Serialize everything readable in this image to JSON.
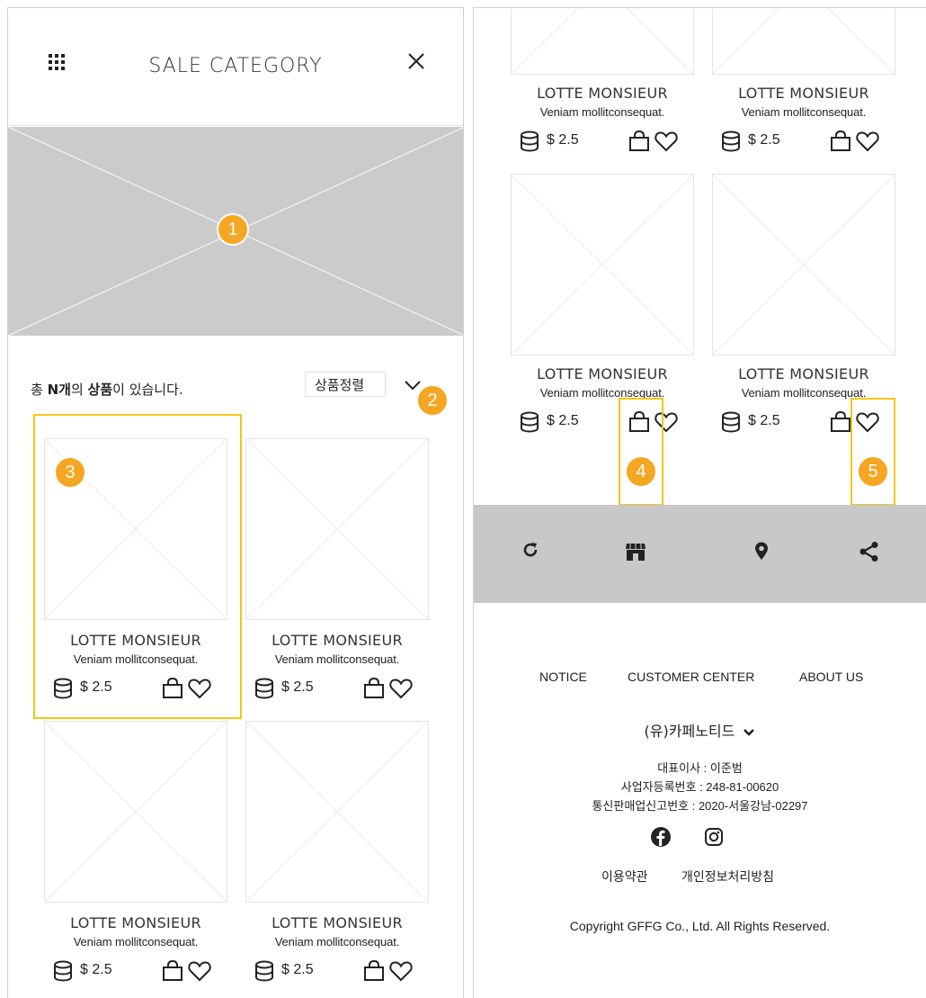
{
  "header": {
    "title": "SALE CATEGORY",
    "menu_icon": "grid-dots-icon",
    "close_icon": "close-icon"
  },
  "list_bar": {
    "count_prefix": "총 ",
    "count_bold_1": "N개",
    "count_mid": "의 ",
    "count_bold_2": "상품",
    "count_suffix": "이 있습니다.",
    "sort_label": "상품정렬"
  },
  "products": [
    {
      "brand": "LOTTE MONSIEUR",
      "name": "Veniam mollitconsequat.",
      "price": "$ 2.5"
    },
    {
      "brand": "LOTTE MONSIEUR",
      "name": "Veniam mollitconsequat.",
      "price": "$ 2.5"
    },
    {
      "brand": "LOTTE MONSIEUR",
      "name": "Veniam mollitconsequat.",
      "price": "$ 2.5"
    },
    {
      "brand": "LOTTE MONSIEUR",
      "name": "Veniam mollitconsequat.",
      "price": "$ 2.5"
    }
  ],
  "right_products": [
    {
      "brand": "LOTTE MONSIEUR",
      "name": "Veniam mollitconsequat.",
      "price": "$ 2.5"
    },
    {
      "brand": "LOTTE MONSIEUR",
      "name": "Veniam mollitconsequat.",
      "price": "$ 2.5"
    },
    {
      "brand": "LOTTE MONSIEUR",
      "name": "Veniam mollitconsequat.",
      "price": "$ 2.5"
    },
    {
      "brand": "LOTTE MONSIEUR",
      "name": "Veniam mollitconsequat.",
      "price": "$ 2.5"
    }
  ],
  "badges": [
    "1",
    "2",
    "3",
    "4",
    "5"
  ],
  "footer_bar": {
    "icons": [
      "refresh-icon",
      "store-icon",
      "location-pin-icon",
      "share-icon"
    ]
  },
  "footer": {
    "links": [
      "NOTICE",
      "CUSTOMER CENTER",
      "ABOUT US"
    ],
    "company": "(유)카페노티드",
    "ceo": "대표이사 : 이준범",
    "biz_no": "사업자등록번호 : 248-81-00620",
    "mail_order_no": "통신판매업신고번호 : 2020-서울강남-02297",
    "social_icons": [
      "facebook-icon",
      "instagram-icon"
    ],
    "terms": "이용약관",
    "privacy": "개인정보처리방침",
    "copyright": "Copyright GFFG Co., Ltd. All Rights Reserved."
  },
  "colors": {
    "badge": "#f5a623",
    "highlight": "#f5c518",
    "banner": "#cbcbcb",
    "footer_bar": "#c8c8c8"
  }
}
